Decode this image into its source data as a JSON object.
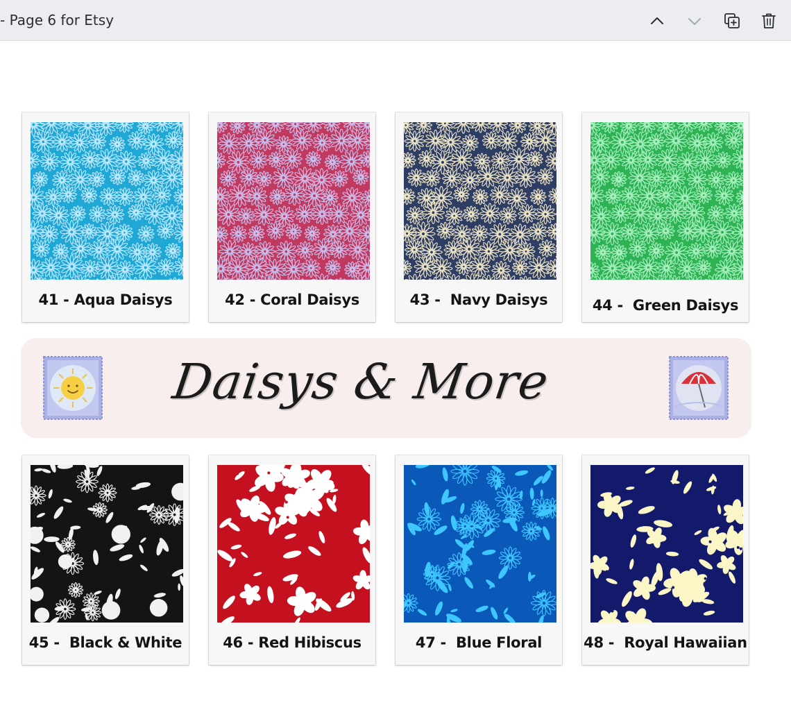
{
  "toolbar": {
    "page_title": "- Page 6 for Etsy",
    "icons": {
      "up": "chevron-up-icon",
      "down": "chevron-down-icon",
      "duplicate": "duplicate-page-icon",
      "delete": "trash-icon"
    }
  },
  "banner": {
    "title": "Daisys & More",
    "background": "#f7eeed",
    "left_stamp": "sun-stamp-icon",
    "right_stamp": "umbrella-stamp-icon"
  },
  "swatches": [
    {
      "label": "41 - Aqua Daisys",
      "bg": "#1fa7d6",
      "fg": "#bfe9ff",
      "pattern": "daisy"
    },
    {
      "label": "42 - Coral Daisys",
      "bg": "#c2395f",
      "fg": "#c8c0ef",
      "pattern": "daisy"
    },
    {
      "label": "43 -  Navy Daisys",
      "bg": "#2e3d63",
      "fg": "#efe6c6",
      "pattern": "daisy"
    },
    {
      "label": "44 -  Green Daisys",
      "bg": "#2eb354",
      "fg": "#a8f0c0",
      "pattern": "daisy"
    },
    {
      "label": "45 -  Black & White",
      "bg": "#141414",
      "fg": "#f1f1f1",
      "pattern": "mixed"
    },
    {
      "label": "46 - Red Hibiscus",
      "bg": "#c4101f",
      "fg": "#ffffff",
      "pattern": "hibiscus"
    },
    {
      "label": "47 -  Blue Floral",
      "bg": "#0a58b8",
      "fg": "#3fc6ff",
      "pattern": "floral"
    },
    {
      "label": "48 -  Royal Hawaiian",
      "bg": "#141a6b",
      "fg": "#fbf6c6",
      "pattern": "hibiscus"
    }
  ]
}
